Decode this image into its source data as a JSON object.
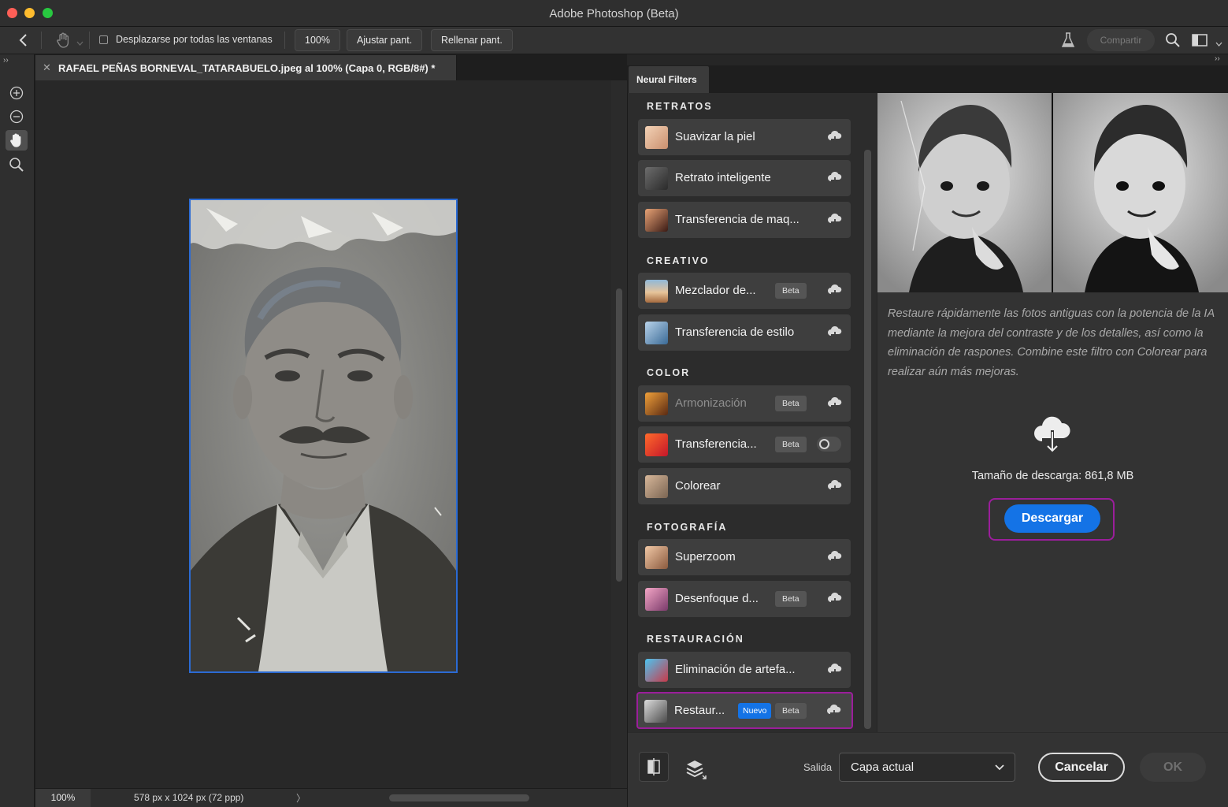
{
  "window": {
    "title": "Adobe Photoshop (Beta)"
  },
  "options_bar": {
    "scroll_all_label": "Desplazarse por todas las ventanas",
    "zoom_100_label": "100%",
    "fit_screen_label": "Ajustar pant.",
    "fill_screen_label": "Rellenar pant.",
    "share_label": "Compartir"
  },
  "document": {
    "tab_title": "RAFAEL PEÑAS BORNEVAL_TATARABUELO.jpeg al 100% (Capa 0, RGB/8#) *",
    "zoom": "100%",
    "dimensions": "578 px x 1024 px (72 ppp)"
  },
  "neural_filters": {
    "panel_title": "Neural Filters",
    "sections": [
      {
        "title": "RETRATOS",
        "items": [
          {
            "label": "Suavizar la piel"
          },
          {
            "label": "Retrato inteligente"
          },
          {
            "label": "Transferencia de maq..."
          }
        ]
      },
      {
        "title": "CREATIVO",
        "items": [
          {
            "label": "Mezclador de...",
            "badge": "Beta"
          },
          {
            "label": "Transferencia de estilo"
          }
        ]
      },
      {
        "title": "COLOR",
        "items": [
          {
            "label": "Armonización",
            "badge": "Beta"
          },
          {
            "label": "Transferencia...",
            "badge": "Beta"
          },
          {
            "label": "Colorear"
          }
        ]
      },
      {
        "title": "FOTOGRAFÍA",
        "items": [
          {
            "label": "Superzoom"
          },
          {
            "label": "Desenfoque d...",
            "badge": "Beta"
          }
        ]
      },
      {
        "title": "RESTAURACIÓN",
        "items": [
          {
            "label": "Eliminación de artefa..."
          },
          {
            "label": "Restaur...",
            "badge_new": "Nuevo",
            "badge": "Beta",
            "selected": true
          }
        ]
      }
    ],
    "description": "Restaure rápidamente las fotos antiguas con la potencia de la IA mediante la mejora del contraste y de los detalles, así como la eliminación de raspones. Combine este filtro con Colorear para realizar aún más mejoras.",
    "download_size": "Tamaño de descarga: 861,8 MB",
    "download_label": "Descargar",
    "output_label": "Salida",
    "output_value": "Capa actual",
    "cancel_label": "Cancelar",
    "ok_label": "OK"
  },
  "colors": {
    "accent_blue": "#1473e6",
    "selection_purple": "#9b1e9b",
    "canvas_selection": "#2b6bd4"
  }
}
